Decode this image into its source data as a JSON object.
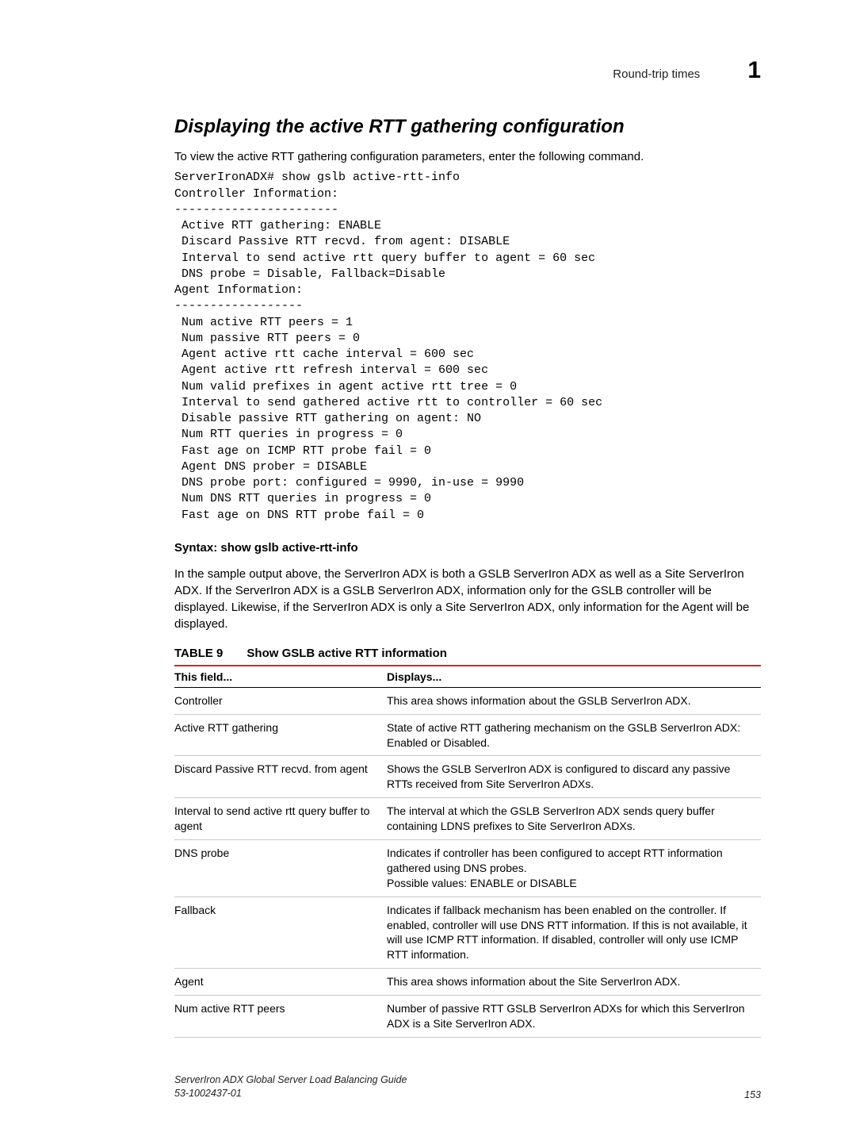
{
  "header": {
    "section_label": "Round-trip times",
    "chapter_number": "1"
  },
  "section_title": "Displaying the active RTT gathering configuration",
  "intro_text": "To view the active RTT gathering configuration parameters, enter the following command.",
  "code_block": "ServerIronADX# show gslb active-rtt-info\nController Information:\n-----------------------\n Active RTT gathering: ENABLE\n Discard Passive RTT recvd. from agent: DISABLE\n Interval to send active rtt query buffer to agent = 60 sec\n DNS probe = Disable, Fallback=Disable\nAgent Information:\n------------------\n Num active RTT peers = 1\n Num passive RTT peers = 0\n Agent active rtt cache interval = 600 sec\n Agent active rtt refresh interval = 600 sec\n Num valid prefixes in agent active rtt tree = 0\n Interval to send gathered active rtt to controller = 60 sec\n Disable passive RTT gathering on agent: NO\n Num RTT queries in progress = 0\n Fast age on ICMP RTT probe fail = 0\n Agent DNS prober = DISABLE\n DNS probe port: configured = 9990, in-use = 9990\n Num DNS RTT queries in progress = 0\n Fast age on DNS RTT probe fail = 0",
  "syntax": {
    "label": "Syntax:",
    "command": "show gslb active-rtt-info"
  },
  "explanation": "In the sample output above, the ServerIron ADX is both a GSLB ServerIron ADX as well as a Site ServerIron ADX. If the ServerIron ADX is a GSLB ServerIron ADX, information only for the GSLB controller will be displayed. Likewise, if the ServerIron ADX is only a Site ServerIron ADX, only information for the Agent will be displayed.",
  "table": {
    "label": "TABLE 9",
    "title": "Show GSLB active RTT information",
    "columns": [
      "This field...",
      "Displays..."
    ],
    "rows": [
      {
        "field": "Controller",
        "displays": "This area shows information about the GSLB ServerIron ADX."
      },
      {
        "field": "Active RTT gathering",
        "displays": "State of active RTT gathering mechanism on the GSLB ServerIron ADX: Enabled or Disabled."
      },
      {
        "field": "Discard Passive RTT recvd. from agent",
        "displays": "Shows the GSLB ServerIron ADX is configured to discard any passive RTTs received from Site ServerIron ADXs."
      },
      {
        "field": "Interval to send active rtt query buffer to agent",
        "displays": "The interval at which the GSLB ServerIron ADX sends query buffer containing LDNS prefixes to Site ServerIron ADXs."
      },
      {
        "field": "DNS probe",
        "displays": "Indicates if controller has been configured to accept RTT information gathered using DNS probes.\nPossible values: ENABLE or DISABLE"
      },
      {
        "field": "Fallback",
        "displays": "Indicates if fallback mechanism has been enabled on the controller. If enabled, controller will use DNS RTT information. If this is not available, it will use ICMP RTT information. If disabled, controller will only use ICMP RTT information."
      },
      {
        "field": "Agent",
        "displays": "This area shows information about the Site ServerIron ADX."
      },
      {
        "field": "Num active RTT peers",
        "displays": "Number of passive RTT GSLB ServerIron ADXs for which this ServerIron ADX is a Site ServerIron ADX."
      }
    ]
  },
  "footer": {
    "guide": "ServerIron ADX Global Server Load Balancing Guide",
    "docnum": "53-1002437-01",
    "page": "153"
  }
}
